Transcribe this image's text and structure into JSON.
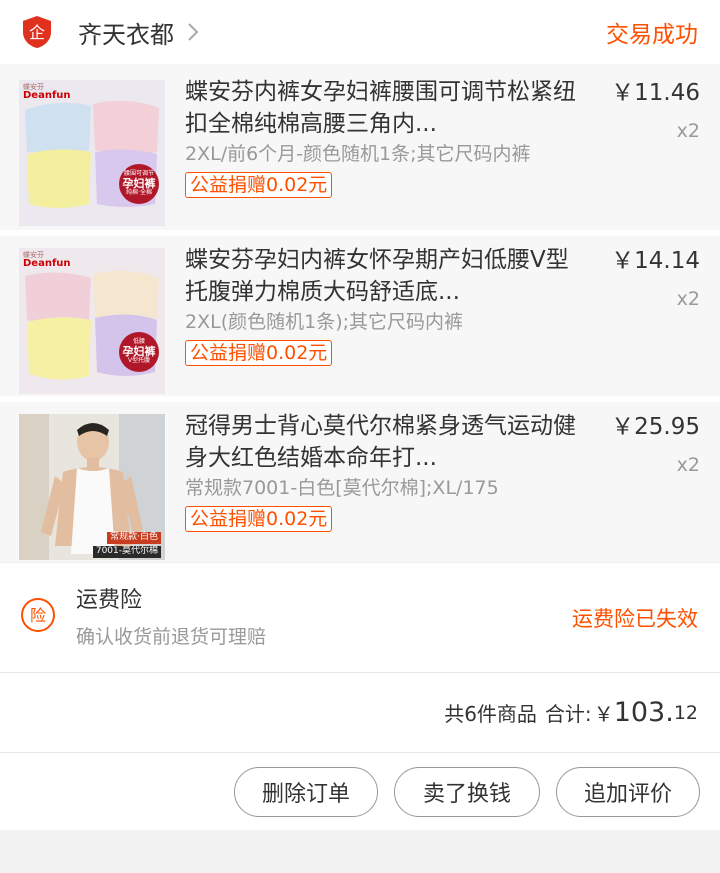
{
  "shop": {
    "name": "齐天衣都",
    "status": "交易成功",
    "badge_glyph": "企",
    "badge_icon": "enterprise-shop-icon",
    "accent": "#ff5000"
  },
  "items": [
    {
      "title": "蝶安芬内裤女孕妇裤腰围可调节松紧纽扣全棉纯棉高腰三角内...",
      "sku": "2XL/前6个月-颜色随机1条;其它尺码内裤",
      "charity": "公益捐赠0.02元",
      "price": "￥11.46",
      "qty": "x2",
      "thumb": {
        "brand_en": "Deanfun",
        "brand_cn": "蝶安芬",
        "tag_top": "腰围可调节",
        "tag_main": "孕妇裤",
        "tag_bottom": "纯棉·全棉"
      }
    },
    {
      "title": "蝶安芬孕妇内裤女怀孕期产妇低腰V型托腹弹力棉质大码舒适底...",
      "sku": "2XL(颜色随机1条);其它尺码内裤",
      "charity": "公益捐赠0.02元",
      "price": "￥14.14",
      "qty": "x2",
      "thumb": {
        "brand_en": "Deanfun",
        "brand_cn": "蝶安芬",
        "tag_top": "低腰",
        "tag_main": "孕妇裤",
        "tag_bottom": "V型托腹"
      }
    },
    {
      "title": "冠得男士背心莫代尔棉紧身透气运动健身大红色结婚本命年打...",
      "sku": "常规款7001-白色[莫代尔棉];XL/175",
      "charity": "公益捐赠0.02元",
      "price": "￥25.95",
      "qty": "x2",
      "thumb": {
        "caption1": "常规款·白色",
        "caption2": "7001-莫代尔棉"
      }
    }
  ],
  "insurance": {
    "icon": "shipping-insurance-icon",
    "glyph": "险",
    "title": "运费险",
    "desc": "确认收货前退货可理赔",
    "status": "运费险已失效"
  },
  "summary": {
    "count": "共6件商品",
    "label": "合计:",
    "yuan": "￥",
    "int": "103.",
    "dec": "12"
  },
  "actions": {
    "delete": "删除订单",
    "resell": "卖了换钱",
    "review": "追加评价"
  }
}
